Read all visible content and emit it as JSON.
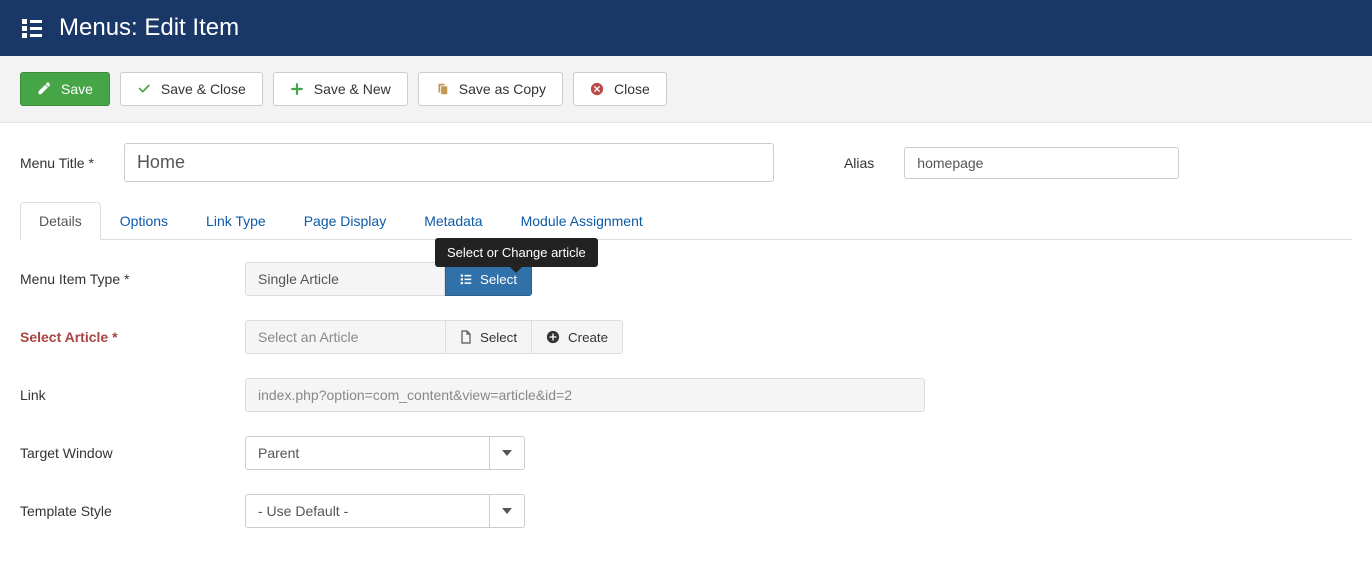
{
  "header": {
    "title": "Menus: Edit Item"
  },
  "toolbar": {
    "save": "Save",
    "save_close": "Save & Close",
    "save_new": "Save & New",
    "save_copy": "Save as Copy",
    "close": "Close"
  },
  "form": {
    "menu_title_label": "Menu Title *",
    "menu_title_value": "Home",
    "alias_label": "Alias",
    "alias_value": "homepage"
  },
  "tabs": [
    {
      "label": "Details",
      "active": true
    },
    {
      "label": "Options",
      "active": false
    },
    {
      "label": "Link Type",
      "active": false
    },
    {
      "label": "Page Display",
      "active": false
    },
    {
      "label": "Metadata",
      "active": false
    },
    {
      "label": "Module Assignment",
      "active": false
    }
  ],
  "details": {
    "menu_item_type_label": "Menu Item Type *",
    "menu_item_type_value": "Single Article",
    "menu_item_type_select": "Select",
    "tooltip": "Select or Change article",
    "select_article_label": "Select Article *",
    "select_article_placeholder": "Select an Article",
    "select_btn": "Select",
    "create_btn": "Create",
    "link_label": "Link",
    "link_value": "index.php?option=com_content&view=article&id=2",
    "target_window_label": "Target Window",
    "target_window_value": "Parent",
    "template_style_label": "Template Style",
    "template_style_value": "- Use Default -"
  }
}
